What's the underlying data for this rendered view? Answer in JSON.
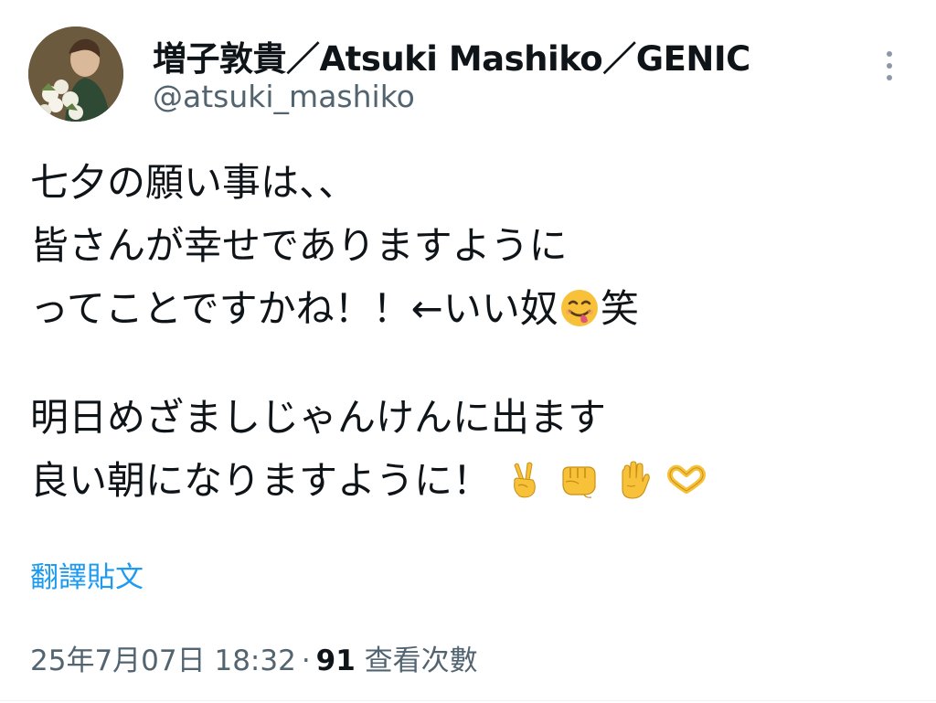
{
  "author": {
    "display_name": "増子敦貴／Atsuki Mashiko／GENIC",
    "handle": "@atsuki_mashiko"
  },
  "tweet": {
    "lines": [
      "七夕の願い事は、、",
      "皆さんが幸せでありますように",
      "ってことですかね！！←いい奴",
      "笑",
      "明日めざましじゃんけんに出ます",
      "良い朝になりますように！"
    ],
    "emojis": [
      "face-savoring-food",
      "victory-hand",
      "oncoming-fist",
      "raised-hand",
      "heart-hands"
    ]
  },
  "translate_label": "翻譯貼文",
  "meta": {
    "timestamp": "25年7月07日 18:32",
    "separator": "·",
    "views_count": "91",
    "views_label": "查看次數"
  },
  "colors": {
    "text": "#0f1419",
    "secondary": "#536471",
    "link": "#1d9bf0",
    "emoji_yellow": "#f7c13a"
  }
}
